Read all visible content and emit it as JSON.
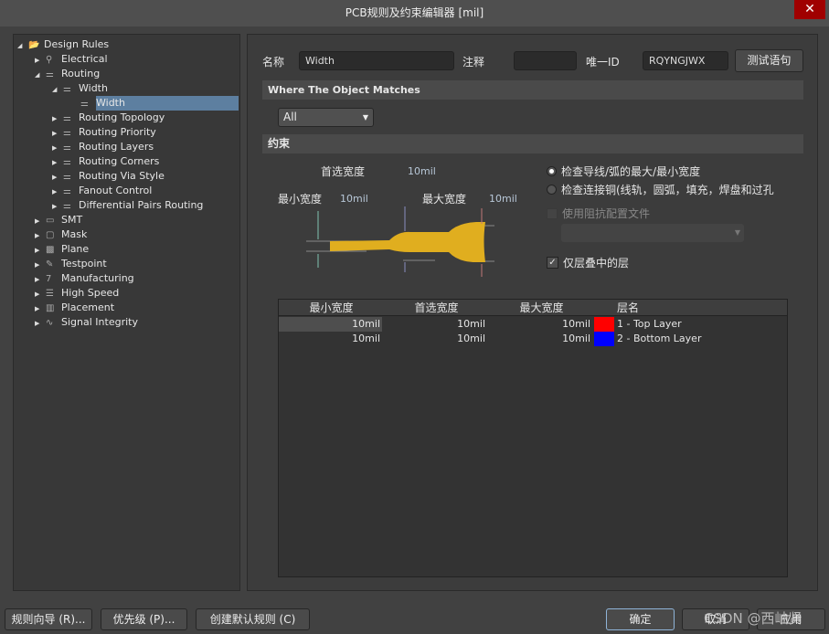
{
  "window": {
    "title": "PCB规则及约束编辑器 [mil]",
    "close": "✕"
  },
  "tree": [
    {
      "label": "Design Rules",
      "level": 0,
      "expanded": true,
      "icon": "design-rules-folder-icon"
    },
    {
      "label": "Electrical",
      "level": 1,
      "icon": "electrical-icon"
    },
    {
      "label": "Routing",
      "level": 1,
      "expanded": true,
      "icon": "routing-icon"
    },
    {
      "label": "Width",
      "level": 2,
      "expanded": true,
      "icon": "routing-icon"
    },
    {
      "label": "Width",
      "level": 3,
      "selected": true,
      "icon": "routing-icon"
    },
    {
      "label": "Routing Topology",
      "level": 2,
      "icon": "routing-icon"
    },
    {
      "label": "Routing Priority",
      "level": 2,
      "icon": "routing-icon"
    },
    {
      "label": "Routing Layers",
      "level": 2,
      "icon": "routing-icon"
    },
    {
      "label": "Routing Corners",
      "level": 2,
      "icon": "routing-icon"
    },
    {
      "label": "Routing Via Style",
      "level": 2,
      "icon": "routing-icon"
    },
    {
      "label": "Fanout Control",
      "level": 2,
      "icon": "routing-icon"
    },
    {
      "label": "Differential Pairs Routing",
      "level": 2,
      "icon": "routing-icon"
    },
    {
      "label": "SMT",
      "level": 1,
      "icon": "smt-icon"
    },
    {
      "label": "Mask",
      "level": 1,
      "icon": "mask-icon"
    },
    {
      "label": "Plane",
      "level": 1,
      "icon": "plane-icon"
    },
    {
      "label": "Testpoint",
      "level": 1,
      "icon": "testpoint-icon"
    },
    {
      "label": "Manufacturing",
      "level": 1,
      "icon": "manufacturing-icon"
    },
    {
      "label": "High Speed",
      "level": 1,
      "icon": "high-speed-icon"
    },
    {
      "label": "Placement",
      "level": 1,
      "icon": "placement-icon"
    },
    {
      "label": "Signal Integrity",
      "level": 1,
      "icon": "signal-integrity-icon"
    }
  ],
  "form": {
    "name_label": "名称",
    "name_value": "Width",
    "comment_label": "注释",
    "comment_value": "",
    "id_label": "唯一ID",
    "id_value": "RQYNGJWX",
    "test_button": "测试语句"
  },
  "match": {
    "header": "Where The Object Matches",
    "select": "All"
  },
  "constraints": {
    "header": "约束",
    "preferred_label": "首选宽度",
    "preferred_value": "10mil",
    "min_label": "最小宽度",
    "min_value": "10mil",
    "max_label": "最大宽度",
    "max_value": "10mil",
    "radio1": "检查导线/弧的最大/最小宽度",
    "radio2": "检查连接铜(线轨，圆弧，填充，焊盘和过孔",
    "radio1_checked": true,
    "impedance_label": "使用阻抗配置文件",
    "impedance_checked": false,
    "stack_label": "仅层叠中的层",
    "stack_checked": true
  },
  "table": {
    "headers": [
      "最小宽度",
      "首选宽度",
      "最大宽度",
      "层名"
    ],
    "rows": [
      {
        "min": "10mil",
        "pref": "10mil",
        "max": "10mil",
        "color": "#ff0000",
        "layer": "1 - Top Layer"
      },
      {
        "min": "10mil",
        "pref": "10mil",
        "max": "10mil",
        "color": "#0000ff",
        "layer": "2 - Bottom Layer"
      }
    ]
  },
  "footer": {
    "wizard": "规则向导 (R)...",
    "priority": "优先级 (P)...",
    "create_default": "创建默认规则 (C)",
    "ok": "确定",
    "cancel": "取消",
    "apply": "应用",
    "watermark": "CSDN @西岫贤"
  }
}
